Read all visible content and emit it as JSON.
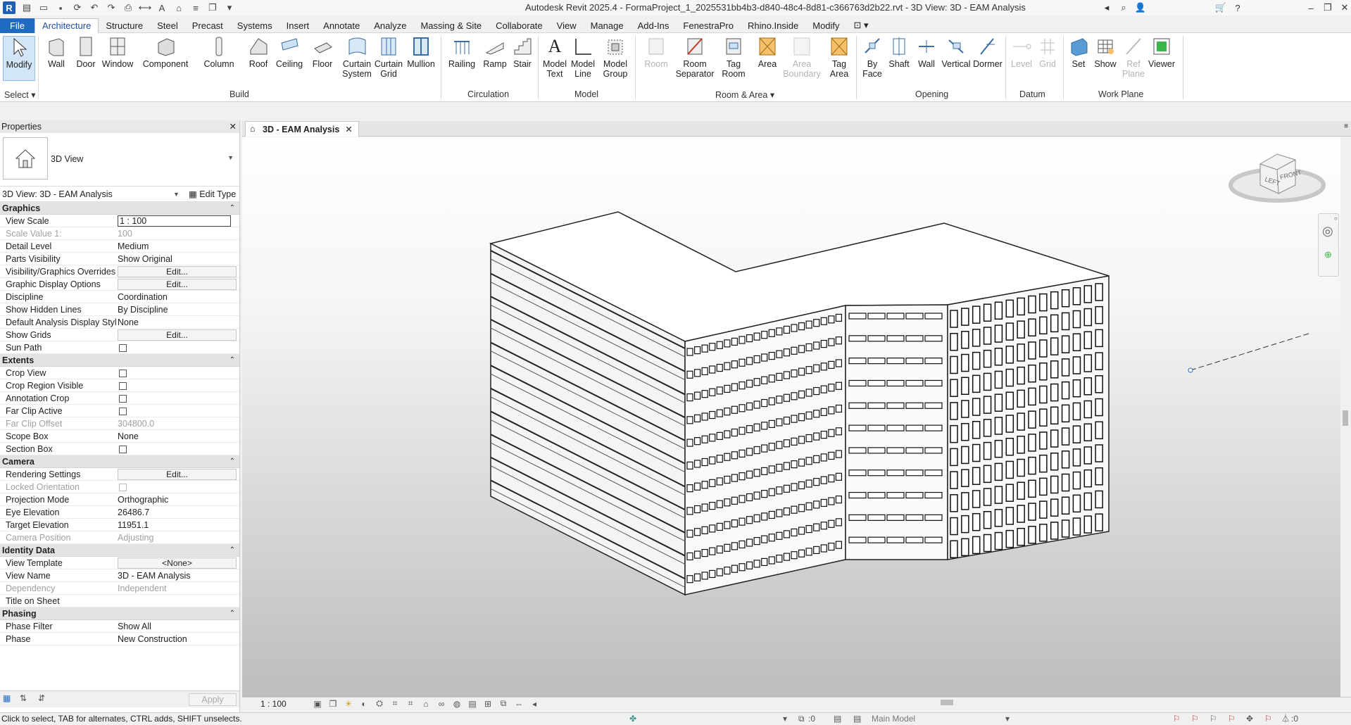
{
  "window": {
    "title": "Autodesk Revit 2025.4 - FormaProject_1_2025531bb4b3-d840-48c4-8d81-c366763d2b22.rvt - 3D View: 3D - EAM Analysis"
  },
  "ribbon_tabs": [
    "File",
    "Architecture",
    "Structure",
    "Steel",
    "Precast",
    "Systems",
    "Insert",
    "Annotate",
    "Analyze",
    "Massing & Site",
    "Collaborate",
    "View",
    "Manage",
    "Add-Ins",
    "FenestraPro",
    "Rhino.Inside",
    "Modify"
  ],
  "active_tab": "Architecture",
  "ribbon": {
    "select": {
      "modify": "Modify",
      "label": "Select"
    },
    "build": {
      "label": "Build",
      "wall": "Wall",
      "door": "Door",
      "window": "Window",
      "component": "Component",
      "column": "Column",
      "roof": "Roof",
      "ceiling": "Ceiling",
      "floor": "Floor",
      "curtain_system": "Curtain System",
      "curtain_grid": "Curtain Grid",
      "mullion": "Mullion"
    },
    "circulation": {
      "label": "Circulation",
      "railing": "Railing",
      "ramp": "Ramp",
      "stair": "Stair"
    },
    "model": {
      "label": "Model",
      "model_text": "Model Text",
      "model_line": "Model Line",
      "model_group": "Model Group"
    },
    "room_area": {
      "label": "Room & Area",
      "room": "Room",
      "room_separator": "Room Separator",
      "tag_room": "Tag Room",
      "area": "Area",
      "area_boundary": "Area Boundary",
      "tag_area": "Tag Area"
    },
    "opening": {
      "label": "Opening",
      "by_face": "By Face",
      "shaft": "Shaft",
      "wall": "Wall",
      "vertical": "Vertical",
      "dormer": "Dormer"
    },
    "datum": {
      "label": "Datum",
      "level": "Level",
      "grid": "Grid"
    },
    "work_plane": {
      "label": "Work Plane",
      "set": "Set",
      "show": "Show",
      "ref_plane": "Ref Plane",
      "viewer": "Viewer"
    }
  },
  "properties": {
    "header": "Properties",
    "type_name": "3D View",
    "instance": "3D View: 3D - EAM Analysis",
    "edit_type": "Edit Type",
    "apply": "Apply",
    "sections": [
      {
        "name": "Graphics",
        "rows": [
          {
            "k": "View Scale",
            "v": "1 : 100",
            "kind": "boxed"
          },
          {
            "k": "Scale Value    1:",
            "v": "100",
            "kind": "gray"
          },
          {
            "k": "Detail Level",
            "v": "Medium"
          },
          {
            "k": "Parts Visibility",
            "v": "Show Original"
          },
          {
            "k": "Visibility/Graphics Overrides",
            "v": "Edit...",
            "kind": "button"
          },
          {
            "k": "Graphic Display Options",
            "v": "Edit...",
            "kind": "button"
          },
          {
            "k": "Discipline",
            "v": "Coordination"
          },
          {
            "k": "Show Hidden Lines",
            "v": "By Discipline"
          },
          {
            "k": "Default Analysis Display Style",
            "v": "None"
          },
          {
            "k": "Show Grids",
            "v": "Edit...",
            "kind": "button"
          },
          {
            "k": "Sun Path",
            "v": "",
            "kind": "check"
          }
        ]
      },
      {
        "name": "Extents",
        "rows": [
          {
            "k": "Crop View",
            "v": "",
            "kind": "check"
          },
          {
            "k": "Crop Region Visible",
            "v": "",
            "kind": "check"
          },
          {
            "k": "Annotation Crop",
            "v": "",
            "kind": "check"
          },
          {
            "k": "Far Clip Active",
            "v": "",
            "kind": "check"
          },
          {
            "k": "Far Clip Offset",
            "v": "304800.0",
            "kind": "gray"
          },
          {
            "k": "Scope Box",
            "v": "None"
          },
          {
            "k": "Section Box",
            "v": "",
            "kind": "check"
          }
        ]
      },
      {
        "name": "Camera",
        "rows": [
          {
            "k": "Rendering Settings",
            "v": "Edit...",
            "kind": "button"
          },
          {
            "k": "Locked Orientation",
            "v": "",
            "kind": "graycheck"
          },
          {
            "k": "Projection Mode",
            "v": "Orthographic"
          },
          {
            "k": "Eye Elevation",
            "v": "26486.7"
          },
          {
            "k": "Target Elevation",
            "v": "11951.1"
          },
          {
            "k": "Camera Position",
            "v": "Adjusting",
            "kind": "gray"
          }
        ]
      },
      {
        "name": "Identity Data",
        "rows": [
          {
            "k": "View Template",
            "v": "<None>",
            "kind": "button"
          },
          {
            "k": "View Name",
            "v": "3D - EAM Analysis"
          },
          {
            "k": "Dependency",
            "v": "Independent",
            "kind": "gray"
          },
          {
            "k": "Title on Sheet",
            "v": ""
          }
        ]
      },
      {
        "name": "Phasing",
        "rows": [
          {
            "k": "Phase Filter",
            "v": "Show All"
          },
          {
            "k": "Phase",
            "v": "New Construction"
          }
        ]
      }
    ]
  },
  "view": {
    "tab_label": "3D - EAM Analysis",
    "scale": "1 : 100",
    "viewcube": {
      "left": "LEFT",
      "front": "FRONT"
    }
  },
  "status": {
    "message": "Click to select, TAB for alternates, CTRL adds, SHIFT unselects.",
    "worksets": ":0",
    "model": "Main Model",
    "filter": ":0"
  }
}
